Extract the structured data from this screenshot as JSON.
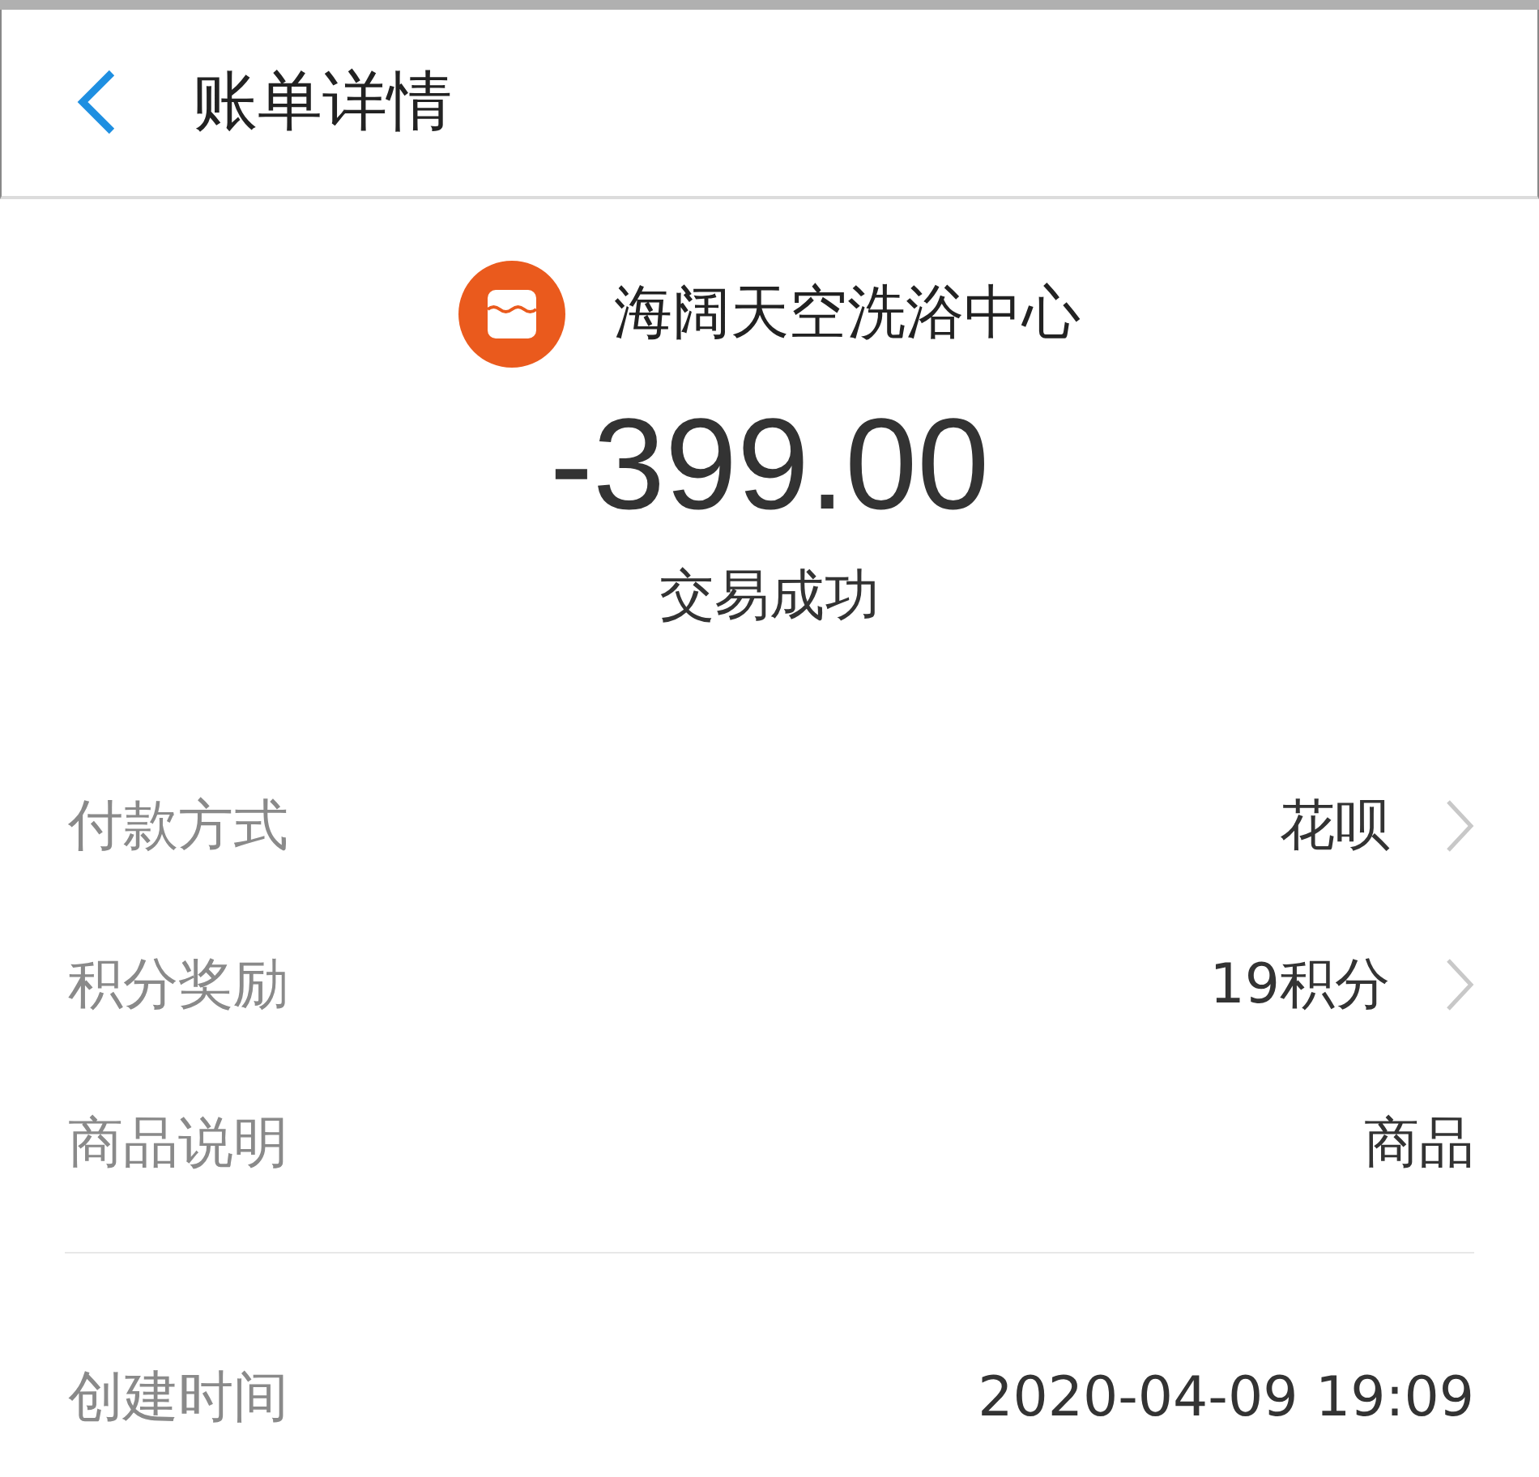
{
  "header": {
    "title": "账单详情"
  },
  "merchant": {
    "name": "海阔天空洗浴中心"
  },
  "amount": "-399.00",
  "status": "交易成功",
  "details": [
    {
      "label": "付款方式",
      "value": "花呗",
      "kind": "link"
    },
    {
      "label": "积分奖励",
      "value": "19积分",
      "kind": "link"
    },
    {
      "label": "商品说明",
      "value": "商品",
      "kind": "plain"
    }
  ],
  "extra": [
    {
      "label": "创建时间",
      "value": "2020-04-09 19:09"
    }
  ]
}
